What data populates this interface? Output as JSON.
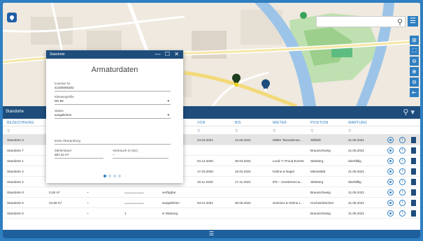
{
  "map": {
    "search_placeholder": "",
    "tools": [
      "⊞",
      "⛶",
      "⊖",
      "⊕",
      "⊖",
      "⇤"
    ]
  },
  "toolbar": {
    "title": "Standorte"
  },
  "table": {
    "headers": [
      "BEZEICHNUNG",
      "VON",
      "BIS",
      "MIETER",
      "POSITION",
      "WARTUNG"
    ],
    "rows": [
      {
        "name": "Standorte 3",
        "von": "24.02.2021",
        "bis": "14.05.2021",
        "mieter": "Müller Tanzadenne...",
        "position": "Stiftelle",
        "wartung": "21.05.2021",
        "selected": true
      },
      {
        "name": "Standorte 7",
        "von": "",
        "bis": "",
        "mieter": "",
        "position": "Braunschweig",
        "wartung": "21.05.2021"
      },
      {
        "name": "Standorte 1",
        "von": "04.12.2020",
        "bis": "30.03.2021",
        "mieter": "Lood 'n' Proud Events",
        "position": "Stiteberg",
        "wartung": "überfällig"
      },
      {
        "name": "Standorte 4",
        "von": "17.03.2020",
        "bis": "16.04.2021",
        "mieter": "Kühne & Nagel",
        "position": "Mönsstädt",
        "wartung": "21.05.2021"
      },
      {
        "name": "Standorte 2",
        "von": "16.11.2020",
        "bis": "17.11.2021",
        "mieter": "IFE – Investment &...",
        "position": "Stiteberg",
        "wartung": "überfällig"
      },
      {
        "name": "Standorte 8",
        "area": "0,28 m³",
        "status": "verfügbar",
        "von": "",
        "bis": "",
        "mieter": "",
        "position": "Braunschweig",
        "wartung": "21.05.2021"
      },
      {
        "name": "Standorte 5",
        "area": "24,89 m³",
        "status": "ausgeliehen",
        "von": "04.01.2021",
        "bis": "30.06.2021",
        "mieter": "Sommer & Söhne L...",
        "position": "Hochweilzschen",
        "wartung": "21.05.2021"
      },
      {
        "name": "Standorte 6",
        "area": "",
        "status": "in Wartung",
        "von": "",
        "bis": "",
        "mieter": "",
        "position": "Braunschweig",
        "wartung": "21.05.2021"
      }
    ]
  },
  "modal": {
    "header": "Standorte",
    "controls": "— ☐ ✕",
    "title": "Armaturdaten",
    "f1_label": "Inventar Nr.",
    "f1_value": "41405006302",
    "f2_label": "Klassengröße",
    "f2_value": "DN 80",
    "f3_label": "Status",
    "f3_value": "ausgeliehen",
    "f4_label": "letzte Überprüfung",
    "f4_value": "",
    "f5_label": "Zählerstand",
    "f5_value": "387,22 m³",
    "f6_label": "Verbrauch (4 Std.)",
    "f6_value": "–"
  },
  "bottom_icon": "☰"
}
